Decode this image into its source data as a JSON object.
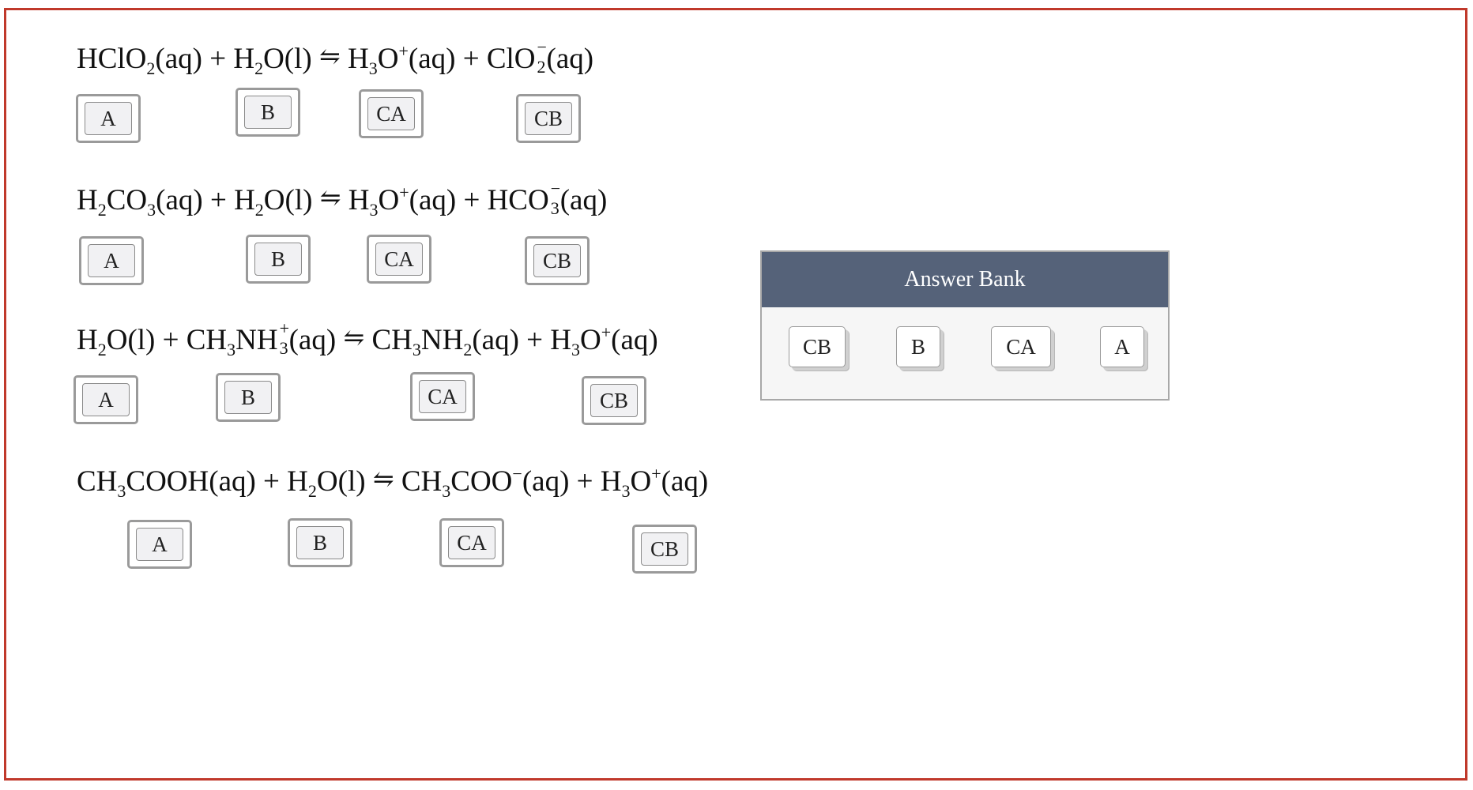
{
  "equations": [
    {
      "slots": [
        "A",
        "B",
        "CA",
        "CB"
      ]
    },
    {
      "slots": [
        "A",
        "B",
        "CA",
        "CB"
      ]
    },
    {
      "slots": [
        "A",
        "B",
        "CA",
        "CB"
      ]
    },
    {
      "slots": [
        "A",
        "B",
        "CA",
        "CB"
      ]
    }
  ],
  "answer_bank": {
    "title": "Answer Bank",
    "items": [
      "CB",
      "B",
      "CA",
      "A"
    ]
  },
  "colors": {
    "frame_border": "#c0392b",
    "bank_header": "#556279"
  }
}
